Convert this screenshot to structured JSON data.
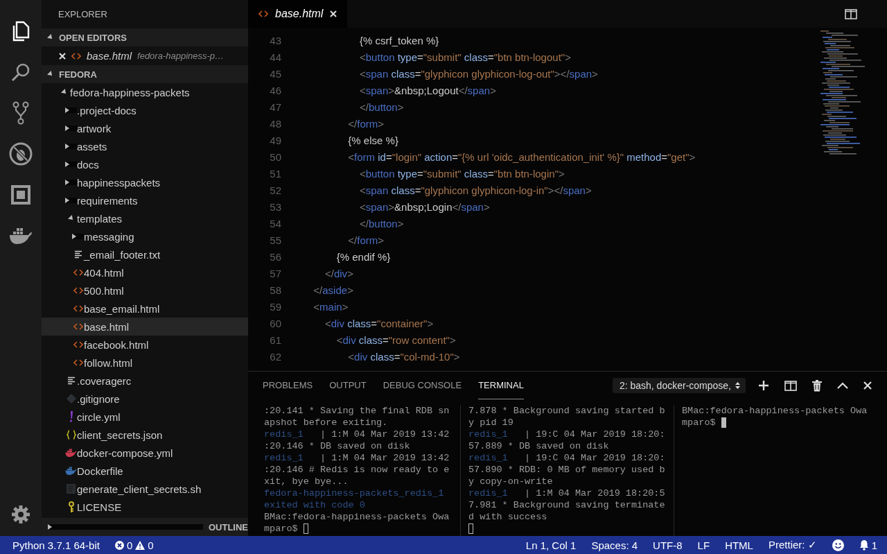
{
  "activity_bar": {
    "items": [
      {
        "kind": "files",
        "selected": true
      },
      {
        "kind": "search",
        "selected": false
      },
      {
        "kind": "source-control",
        "selected": false
      },
      {
        "kind": "debug",
        "selected": false
      },
      {
        "kind": "extensions",
        "selected": false
      },
      {
        "kind": "docker",
        "selected": false
      }
    ],
    "bottom": [
      {
        "kind": "settings",
        "selected": false
      }
    ]
  },
  "sidebar": {
    "title": "EXPLORER",
    "open_editors": {
      "title": "OPEN EDITORS",
      "expanded": true,
      "items": [
        {
          "name": "base.html",
          "path": "fedora-happiness-p…",
          "kind": "html",
          "preview": true
        }
      ]
    },
    "workspace": {
      "title": "FEDORA",
      "expanded": true,
      "tree": [
        {
          "name": "fedora-happiness-packets",
          "kind": "folder",
          "expanded": true,
          "selected": false,
          "children": [
            {
              "name": ".project-docs",
              "kind": "folder",
              "expanded": false,
              "selected": false
            },
            {
              "name": "artwork",
              "kind": "folder",
              "expanded": false,
              "selected": false
            },
            {
              "name": "assets",
              "kind": "folder",
              "expanded": false,
              "selected": false
            },
            {
              "name": "docs",
              "kind": "folder",
              "expanded": false,
              "selected": false
            },
            {
              "name": "happinesspackets",
              "kind": "folder",
              "expanded": false,
              "selected": false
            },
            {
              "name": "requirements",
              "kind": "folder",
              "expanded": false,
              "selected": false
            },
            {
              "name": "templates",
              "kind": "folder",
              "expanded": true,
              "selected": false,
              "children": [
                {
                  "name": "messaging",
                  "kind": "folder",
                  "expanded": false,
                  "selected": false
                },
                {
                  "name": "_email_footer.txt",
                  "kind": "text",
                  "selected": false
                },
                {
                  "name": "404.html",
                  "kind": "html",
                  "selected": false
                },
                {
                  "name": "500.html",
                  "kind": "html",
                  "selected": false
                },
                {
                  "name": "base_email.html",
                  "kind": "html",
                  "selected": false
                },
                {
                  "name": "base.html",
                  "kind": "html",
                  "selected": true
                },
                {
                  "name": "facebook.html",
                  "kind": "html",
                  "selected": false
                },
                {
                  "name": "follow.html",
                  "kind": "html",
                  "selected": false
                }
              ]
            },
            {
              "name": ".coveragerc",
              "kind": "text",
              "selected": false
            },
            {
              "name": ".gitignore",
              "kind": "git",
              "selected": false
            },
            {
              "name": "circle.yml",
              "kind": "yaml",
              "selected": false
            },
            {
              "name": "client_secrets.json",
              "kind": "json",
              "selected": false
            },
            {
              "name": "docker-compose.yml",
              "kind": "compose",
              "selected": false
            },
            {
              "name": "Dockerfile",
              "kind": "docker",
              "selected": false
            },
            {
              "name": "generate_client_secrets.sh",
              "kind": "shell",
              "selected": false
            },
            {
              "name": "LICENSE",
              "kind": "license",
              "selected": false
            }
          ]
        }
      ]
    },
    "outline": {
      "title": "OUTLINE",
      "expanded": false
    }
  },
  "editor": {
    "tabs": [
      {
        "name": "base.html",
        "kind": "html",
        "preview": true,
        "selected": true
      }
    ],
    "lines": [
      {
        "number": "43",
        "tokens": [
          {
            "kind": "text",
            "text": "                        {% csrf_token %}"
          }
        ]
      },
      {
        "number": "44",
        "tokens": [
          {
            "kind": "punct",
            "text": "                        <"
          },
          {
            "kind": "tag",
            "text": "button"
          },
          {
            "kind": "attr",
            "text": " type"
          },
          {
            "kind": "text",
            "text": "="
          },
          {
            "kind": "string",
            "text": "\"submit\""
          },
          {
            "kind": "attr",
            "text": " class"
          },
          {
            "kind": "text",
            "text": "="
          },
          {
            "kind": "string",
            "text": "\"btn btn-logout\""
          },
          {
            "kind": "punct",
            "text": ">"
          }
        ]
      },
      {
        "number": "45",
        "tokens": [
          {
            "kind": "punct",
            "text": "                        <"
          },
          {
            "kind": "tag",
            "text": "span"
          },
          {
            "kind": "attr",
            "text": " class"
          },
          {
            "kind": "text",
            "text": "="
          },
          {
            "kind": "string",
            "text": "\"glyphicon glyphicon-log-out\""
          },
          {
            "kind": "punct",
            "text": "></"
          },
          {
            "kind": "tag",
            "text": "span"
          },
          {
            "kind": "punct",
            "text": ">"
          }
        ]
      },
      {
        "number": "46",
        "tokens": [
          {
            "kind": "punct",
            "text": "                        <"
          },
          {
            "kind": "tag",
            "text": "span"
          },
          {
            "kind": "punct",
            "text": ">"
          },
          {
            "kind": "text",
            "text": "&nbsp;Logout"
          },
          {
            "kind": "punct",
            "text": "</"
          },
          {
            "kind": "tag",
            "text": "span"
          },
          {
            "kind": "punct",
            "text": ">"
          }
        ]
      },
      {
        "number": "47",
        "tokens": [
          {
            "kind": "punct",
            "text": "                        </"
          },
          {
            "kind": "tag",
            "text": "button"
          },
          {
            "kind": "punct",
            "text": ">"
          }
        ]
      },
      {
        "number": "48",
        "tokens": [
          {
            "kind": "punct",
            "text": "                    </"
          },
          {
            "kind": "tag",
            "text": "form"
          },
          {
            "kind": "punct",
            "text": ">"
          }
        ]
      },
      {
        "number": "49",
        "tokens": [
          {
            "kind": "text",
            "text": "                    {% else %}"
          }
        ]
      },
      {
        "number": "50",
        "tokens": [
          {
            "kind": "punct",
            "text": "                    <"
          },
          {
            "kind": "tag",
            "text": "form"
          },
          {
            "kind": "attr",
            "text": " id"
          },
          {
            "kind": "text",
            "text": "="
          },
          {
            "kind": "string",
            "text": "\"login\""
          },
          {
            "kind": "attr",
            "text": " action"
          },
          {
            "kind": "text",
            "text": "="
          },
          {
            "kind": "string",
            "text": "\"{% url 'oidc_authentication_init' %}\""
          },
          {
            "kind": "attr",
            "text": " method"
          },
          {
            "kind": "text",
            "text": "="
          },
          {
            "kind": "string",
            "text": "\"get\""
          },
          {
            "kind": "punct",
            "text": ">"
          }
        ]
      },
      {
        "number": "51",
        "tokens": [
          {
            "kind": "punct",
            "text": "                        <"
          },
          {
            "kind": "tag",
            "text": "button"
          },
          {
            "kind": "attr",
            "text": " type"
          },
          {
            "kind": "text",
            "text": "="
          },
          {
            "kind": "string",
            "text": "\"submit\""
          },
          {
            "kind": "attr",
            "text": " class"
          },
          {
            "kind": "text",
            "text": "="
          },
          {
            "kind": "string",
            "text": "\"btn btn-login\""
          },
          {
            "kind": "punct",
            "text": ">"
          }
        ]
      },
      {
        "number": "52",
        "tokens": [
          {
            "kind": "punct",
            "text": "                        <"
          },
          {
            "kind": "tag",
            "text": "span"
          },
          {
            "kind": "attr",
            "text": " class"
          },
          {
            "kind": "text",
            "text": "="
          },
          {
            "kind": "string",
            "text": "\"glyphicon glyphicon-log-in\""
          },
          {
            "kind": "punct",
            "text": "></"
          },
          {
            "kind": "tag",
            "text": "span"
          },
          {
            "kind": "punct",
            "text": ">"
          }
        ]
      },
      {
        "number": "53",
        "tokens": [
          {
            "kind": "punct",
            "text": "                        <"
          },
          {
            "kind": "tag",
            "text": "span"
          },
          {
            "kind": "punct",
            "text": ">"
          },
          {
            "kind": "text",
            "text": "&nbsp;Login"
          },
          {
            "kind": "punct",
            "text": "</"
          },
          {
            "kind": "tag",
            "text": "span"
          },
          {
            "kind": "punct",
            "text": ">"
          }
        ]
      },
      {
        "number": "54",
        "tokens": [
          {
            "kind": "punct",
            "text": "                        </"
          },
          {
            "kind": "tag",
            "text": "button"
          },
          {
            "kind": "punct",
            "text": ">"
          }
        ]
      },
      {
        "number": "55",
        "tokens": [
          {
            "kind": "punct",
            "text": "                    </"
          },
          {
            "kind": "tag",
            "text": "form"
          },
          {
            "kind": "punct",
            "text": ">"
          }
        ]
      },
      {
        "number": "56",
        "tokens": [
          {
            "kind": "text",
            "text": "                {% endif %}"
          }
        ]
      },
      {
        "number": "57",
        "tokens": [
          {
            "kind": "punct",
            "text": "            </"
          },
          {
            "kind": "tag",
            "text": "div"
          },
          {
            "kind": "punct",
            "text": ">"
          }
        ]
      },
      {
        "number": "58",
        "tokens": [
          {
            "kind": "punct",
            "text": "        </"
          },
          {
            "kind": "tag",
            "text": "aside"
          },
          {
            "kind": "punct",
            "text": ">"
          }
        ]
      },
      {
        "number": "59",
        "tokens": [
          {
            "kind": "punct",
            "text": "        <"
          },
          {
            "kind": "tag",
            "text": "main"
          },
          {
            "kind": "punct",
            "text": ">"
          }
        ]
      },
      {
        "number": "60",
        "tokens": [
          {
            "kind": "punct",
            "text": "            <"
          },
          {
            "kind": "tag",
            "text": "div"
          },
          {
            "kind": "attr",
            "text": " class"
          },
          {
            "kind": "text",
            "text": "="
          },
          {
            "kind": "string",
            "text": "\"container\""
          },
          {
            "kind": "punct",
            "text": ">"
          }
        ]
      },
      {
        "number": "61",
        "tokens": [
          {
            "kind": "punct",
            "text": "                <"
          },
          {
            "kind": "tag",
            "text": "div"
          },
          {
            "kind": "attr",
            "text": " class"
          },
          {
            "kind": "text",
            "text": "="
          },
          {
            "kind": "string",
            "text": "\"row content\""
          },
          {
            "kind": "punct",
            "text": ">"
          }
        ]
      },
      {
        "number": "62",
        "tokens": [
          {
            "kind": "punct",
            "text": "                    <"
          },
          {
            "kind": "tag",
            "text": "div"
          },
          {
            "kind": "attr",
            "text": " class"
          },
          {
            "kind": "text",
            "text": "="
          },
          {
            "kind": "string",
            "text": "\"col-md-10\""
          },
          {
            "kind": "punct",
            "text": ">"
          }
        ]
      }
    ]
  },
  "panel": {
    "tabs": [
      {
        "label": "PROBLEMS",
        "selected": false
      },
      {
        "label": "OUTPUT",
        "selected": false
      },
      {
        "label": "DEBUG CONSOLE",
        "selected": false
      },
      {
        "label": "TERMINAL",
        "selected": true
      }
    ],
    "terminal_select": "2: bash, docker-compose,",
    "panes": [
      {
        "focused": false,
        "prompt": "mparo$ ",
        "lines": [
          [
            {
              "kind": "log",
              "text": ":20.141 * Saving the final RDB sn"
            }
          ],
          [
            {
              "kind": "log",
              "text": "apshot before exiting."
            }
          ],
          [
            {
              "kind": "service",
              "text": "redis_1"
            },
            {
              "kind": "log",
              "text": "   | 1:M 04 Mar 2019 13:42"
            }
          ],
          [
            {
              "kind": "log",
              "text": ":20.146 * DB saved on disk"
            }
          ],
          [
            {
              "kind": "service",
              "text": "redis_1"
            },
            {
              "kind": "log",
              "text": "   | 1:M 04 Mar 2019 13:42"
            }
          ],
          [
            {
              "kind": "log",
              "text": ":20.146 # Redis is now ready to e"
            }
          ],
          [
            {
              "kind": "log",
              "text": "xit, bye bye..."
            }
          ],
          [
            {
              "kind": "service",
              "text": "fedora-happiness-packets_redis_1"
            }
          ],
          [
            {
              "kind": "service",
              "text": "exited with code 0"
            }
          ],
          [
            {
              "kind": "log",
              "text": "BMac:fedora-happiness-packets Owa"
            }
          ]
        ]
      },
      {
        "focused": false,
        "lines": [
          [
            {
              "kind": "log",
              "text": "7.878 * Background saving started b"
            }
          ],
          [
            {
              "kind": "log",
              "text": "y pid 19"
            }
          ],
          [
            {
              "kind": "service",
              "text": "redis_1"
            },
            {
              "kind": "log",
              "text": "   | 19:C 04 Mar 2019 18:20:"
            }
          ],
          [
            {
              "kind": "log",
              "text": "57.889 * DB saved on disk"
            }
          ],
          [
            {
              "kind": "service",
              "text": "redis_1"
            },
            {
              "kind": "log",
              "text": "   | 19:C 04 Mar 2019 18:20:"
            }
          ],
          [
            {
              "kind": "log",
              "text": "57.890 * RDB: 0 MB of memory used b"
            }
          ],
          [
            {
              "kind": "log",
              "text": "y copy-on-write"
            }
          ],
          [
            {
              "kind": "service",
              "text": "redis_1"
            },
            {
              "kind": "log",
              "text": "   | 1:M 04 Mar 2019 18:20:5"
            }
          ],
          [
            {
              "kind": "log",
              "text": "7.981 * Background saving terminate"
            }
          ],
          [
            {
              "kind": "log",
              "text": "d with success"
            }
          ]
        ]
      },
      {
        "focused": true,
        "prompt": "mparo$ ",
        "lines": [
          [
            {
              "kind": "log",
              "text": "BMac:fedora-happiness-packets Owa"
            }
          ]
        ]
      }
    ]
  },
  "status_bar": {
    "left": [
      {
        "kind": "text",
        "text": "Python 3.7.1 64-bit"
      },
      {
        "kind": "problems",
        "errors": "0",
        "warnings": "0"
      }
    ],
    "right": [
      {
        "kind": "text",
        "text": "Ln 1, Col 1"
      },
      {
        "kind": "text",
        "text": "Spaces: 4"
      },
      {
        "kind": "text",
        "text": "UTF-8"
      },
      {
        "kind": "text",
        "text": "LF"
      },
      {
        "kind": "text",
        "text": "HTML"
      },
      {
        "kind": "text",
        "text": "Prettier: ✓"
      },
      {
        "kind": "feedback"
      },
      {
        "kind": "notifications",
        "count": "1"
      }
    ]
  }
}
